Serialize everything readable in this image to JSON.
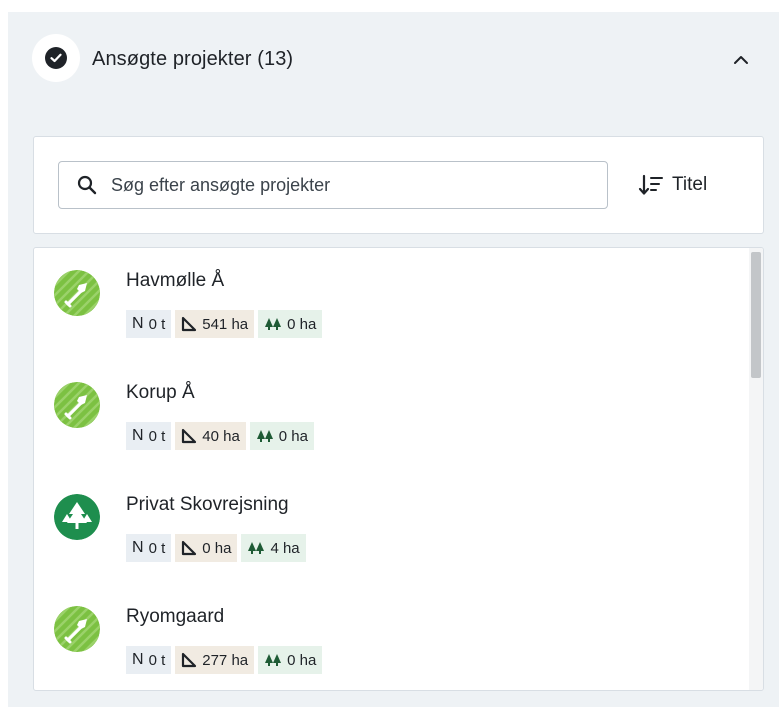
{
  "header": {
    "title": "Ansøgte projekter (13)",
    "status_icon": "check-circle-icon",
    "collapse_icon": "chevron-up-icon"
  },
  "search": {
    "placeholder": "Søg efter ansøgte projekter",
    "value": "",
    "icon": "search-icon"
  },
  "sort": {
    "label": "Titel",
    "icon": "sort-descending-icon"
  },
  "projects": [
    {
      "title": "Havmølle Å",
      "type_icon": "shovel-icon",
      "n_label": "N",
      "n_value": "0 t",
      "area": "541 ha",
      "forest": "0 ha"
    },
    {
      "title": "Korup Å",
      "type_icon": "shovel-icon",
      "n_label": "N",
      "n_value": "0 t",
      "area": "40 ha",
      "forest": "0 ha"
    },
    {
      "title": "Privat Skovrejsning",
      "type_icon": "trees-icon",
      "n_label": "N",
      "n_value": "0 t",
      "area": "0 ha",
      "forest": "4 ha"
    },
    {
      "title": "Ryomgaard",
      "type_icon": "shovel-icon",
      "n_label": "N",
      "n_value": "0 t",
      "area": "277 ha",
      "forest": "0 ha"
    }
  ],
  "colors": {
    "panel_bg": "#eef2f5",
    "nature_green": "#7cc142",
    "forest_green": "#1e8e4e",
    "text": "#1f2328",
    "n_badge_bg": "#e9eef3",
    "area_badge_bg": "#f1ebe2",
    "forest_badge_bg": "#e6f2ea"
  }
}
